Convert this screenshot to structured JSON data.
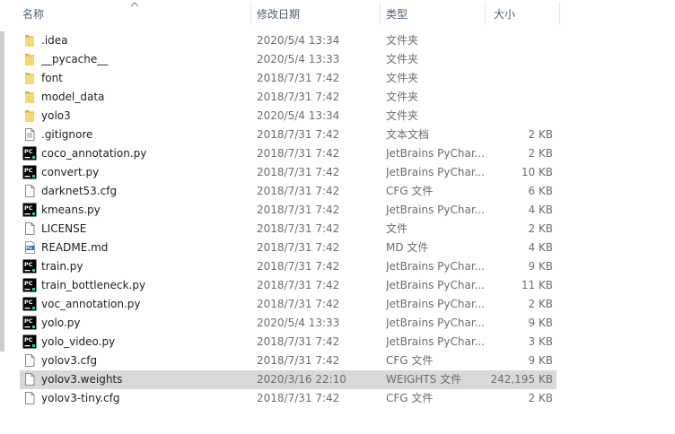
{
  "columns": {
    "name": "名称",
    "date": "修改日期",
    "type": "类型",
    "size": "大小"
  },
  "files": [
    {
      "name": ".idea",
      "date": "2020/5/4 13:34",
      "type": "文件夹",
      "size": "",
      "icon": "folder-icon"
    },
    {
      "name": "__pycache__",
      "date": "2020/5/4 13:33",
      "type": "文件夹",
      "size": "",
      "icon": "folder-icon"
    },
    {
      "name": "font",
      "date": "2018/7/31 7:42",
      "type": "文件夹",
      "size": "",
      "icon": "folder-icon"
    },
    {
      "name": "model_data",
      "date": "2018/7/31 7:42",
      "type": "文件夹",
      "size": "",
      "icon": "folder-icon"
    },
    {
      "name": "yolo3",
      "date": "2020/5/4 13:34",
      "type": "文件夹",
      "size": "",
      "icon": "folder-icon"
    },
    {
      "name": ".gitignore",
      "date": "2018/7/31 7:42",
      "type": "文本文档",
      "size": "2 KB",
      "icon": "text-file-icon"
    },
    {
      "name": "coco_annotation.py",
      "date": "2018/7/31 7:42",
      "type": "JetBrains PyChar...",
      "size": "2 KB",
      "icon": "pycharm-file-icon"
    },
    {
      "name": "convert.py",
      "date": "2018/7/31 7:42",
      "type": "JetBrains PyChar...",
      "size": "10 KB",
      "icon": "pycharm-file-icon"
    },
    {
      "name": "darknet53.cfg",
      "date": "2018/7/31 7:42",
      "type": "CFG 文件",
      "size": "6 KB",
      "icon": "blank-file-icon"
    },
    {
      "name": "kmeans.py",
      "date": "2018/7/31 7:42",
      "type": "JetBrains PyChar...",
      "size": "4 KB",
      "icon": "pycharm-file-icon"
    },
    {
      "name": "LICENSE",
      "date": "2018/7/31 7:42",
      "type": "文件",
      "size": "2 KB",
      "icon": "blank-file-icon"
    },
    {
      "name": "README.md",
      "date": "2018/7/31 7:42",
      "type": "MD 文件",
      "size": "4 KB",
      "icon": "markdown-file-icon"
    },
    {
      "name": "train.py",
      "date": "2018/7/31 7:42",
      "type": "JetBrains PyChar...",
      "size": "9 KB",
      "icon": "pycharm-file-icon"
    },
    {
      "name": "train_bottleneck.py",
      "date": "2018/7/31 7:42",
      "type": "JetBrains PyChar...",
      "size": "11 KB",
      "icon": "pycharm-file-icon"
    },
    {
      "name": "voc_annotation.py",
      "date": "2018/7/31 7:42",
      "type": "JetBrains PyChar...",
      "size": "2 KB",
      "icon": "pycharm-file-icon"
    },
    {
      "name": "yolo.py",
      "date": "2020/5/4 13:33",
      "type": "JetBrains PyChar...",
      "size": "9 KB",
      "icon": "pycharm-file-icon"
    },
    {
      "name": "yolo_video.py",
      "date": "2018/7/31 7:42",
      "type": "JetBrains PyChar...",
      "size": "3 KB",
      "icon": "pycharm-file-icon"
    },
    {
      "name": "yolov3.cfg",
      "date": "2018/7/31 7:42",
      "type": "CFG 文件",
      "size": "9 KB",
      "icon": "blank-file-icon"
    },
    {
      "name": "yolov3.weights",
      "date": "2020/3/16 22:10",
      "type": "WEIGHTS 文件",
      "size": "242,195 KB",
      "icon": "blank-file-icon",
      "selected": true
    },
    {
      "name": "yolov3-tiny.cfg",
      "date": "2018/7/31 7:42",
      "type": "CFG 文件",
      "size": "2 KB",
      "icon": "blank-file-icon"
    }
  ],
  "status": {
    "text": ""
  },
  "colors": {
    "selection": "#d9d9d9",
    "folder": "#f8d775",
    "pycharm": "#000000",
    "pycharm_accent": "#21d789"
  }
}
